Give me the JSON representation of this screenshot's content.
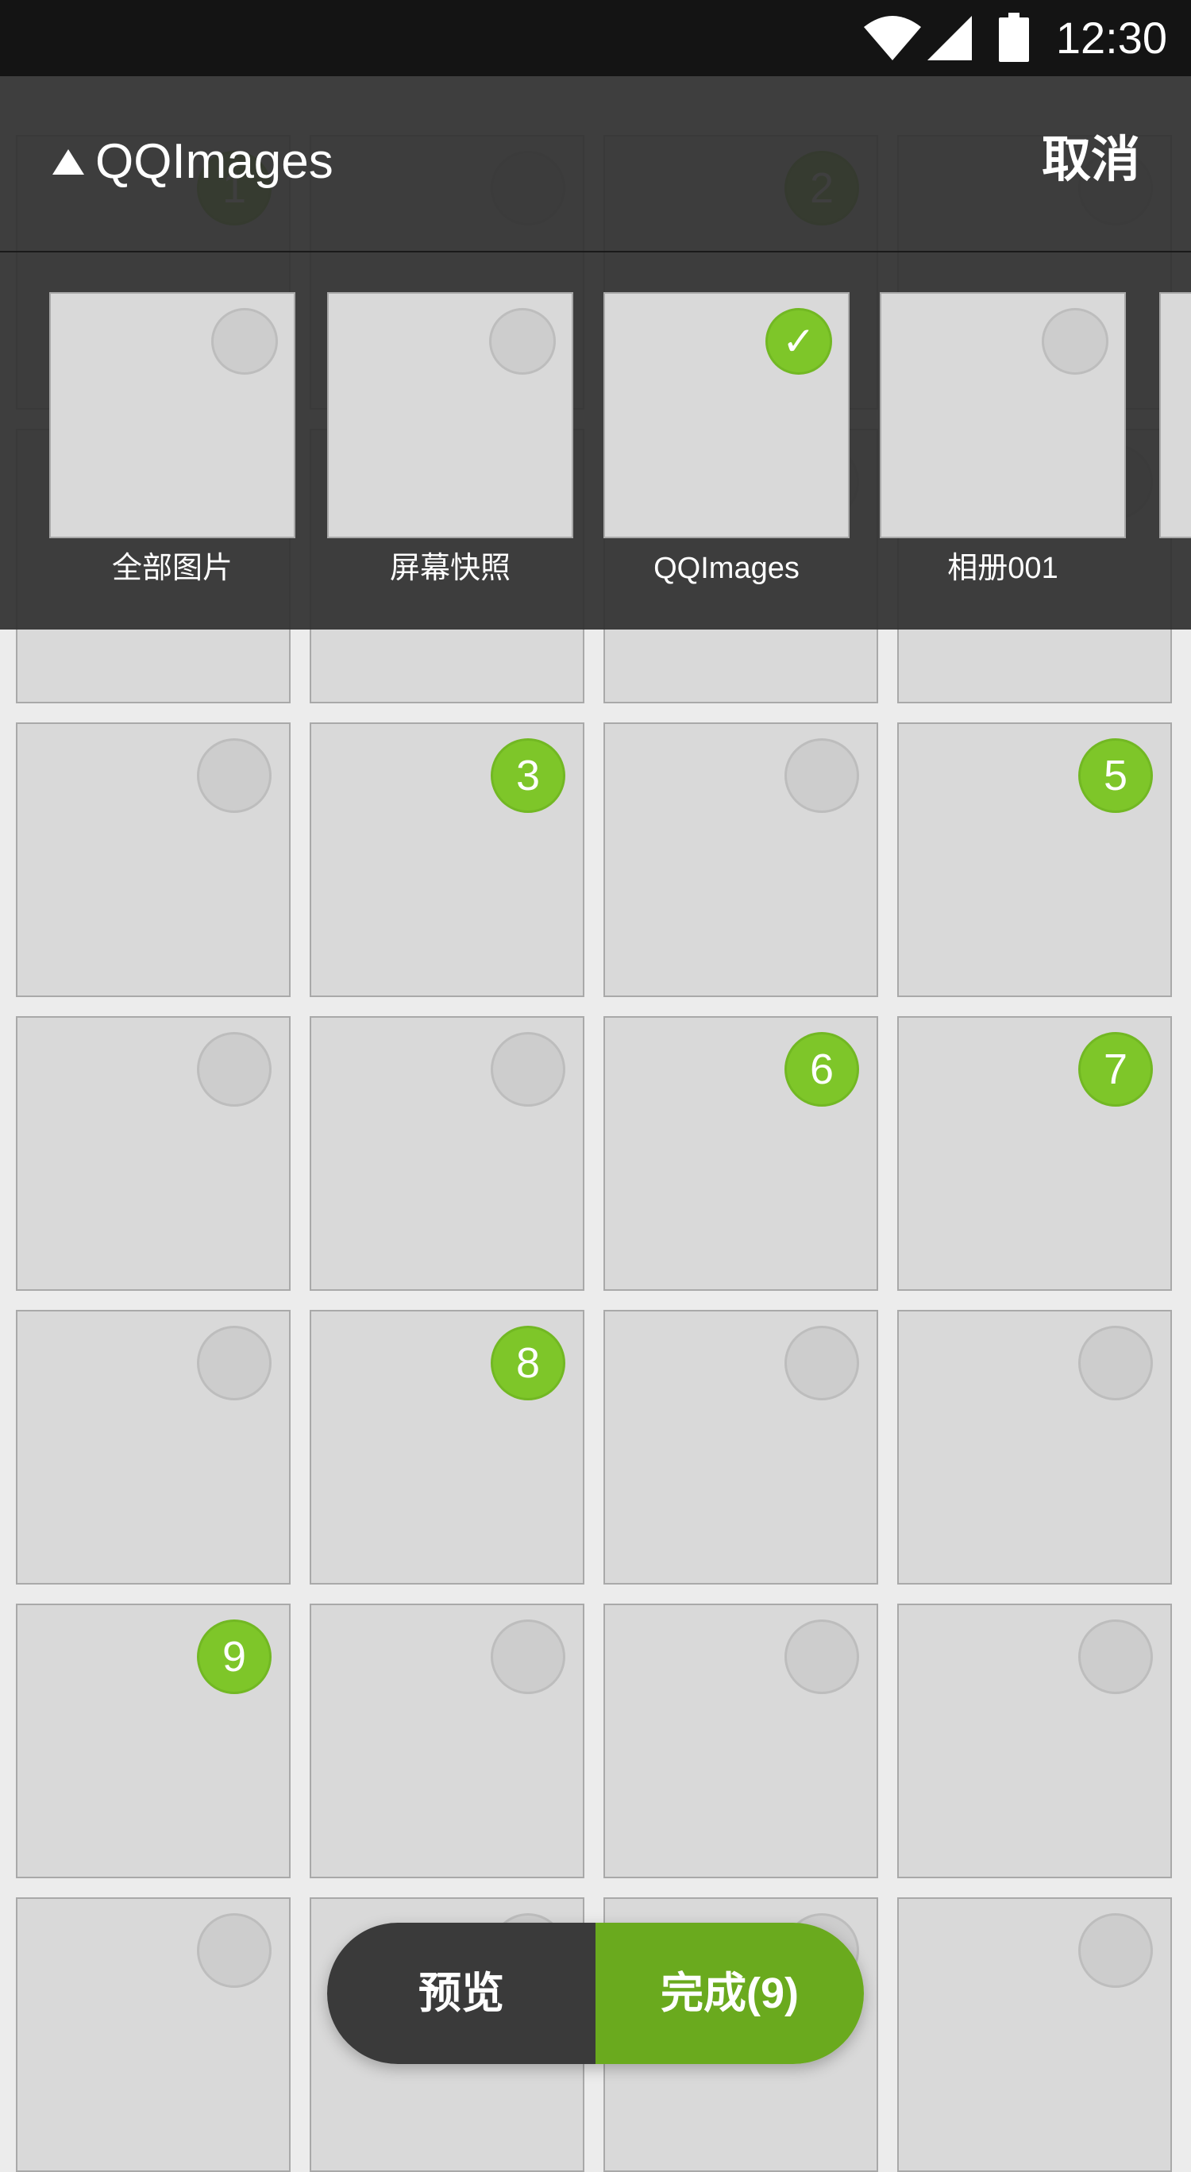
{
  "status": {
    "time": "12:30",
    "icons": [
      "wifi-icon",
      "signal-icon",
      "battery-icon"
    ]
  },
  "header": {
    "album_title": "QQImages",
    "cancel_label": "取消"
  },
  "folders": [
    {
      "name": "全部图片",
      "selected": false,
      "check": ""
    },
    {
      "name": "屏幕快照",
      "selected": false,
      "check": ""
    },
    {
      "name": "QQImages",
      "selected": true,
      "check": "✓"
    },
    {
      "name": "相册001",
      "selected": false,
      "check": ""
    }
  ],
  "grid": {
    "rows": [
      [
        "1",
        "",
        "2",
        ""
      ],
      [
        "",
        "",
        "",
        ""
      ],
      [
        "",
        "3",
        "",
        "5"
      ],
      [
        "",
        "",
        "6",
        "7"
      ],
      [
        "",
        "8",
        "",
        ""
      ],
      [
        "9",
        "",
        "",
        ""
      ],
      [
        "",
        "",
        "",
        ""
      ]
    ]
  },
  "actions": {
    "preview_label": "预览",
    "done_label": "完成(9)"
  },
  "colors": {
    "accent": "#7ec629",
    "accent_dark": "#6aaa1e",
    "overlay": "#303030"
  }
}
